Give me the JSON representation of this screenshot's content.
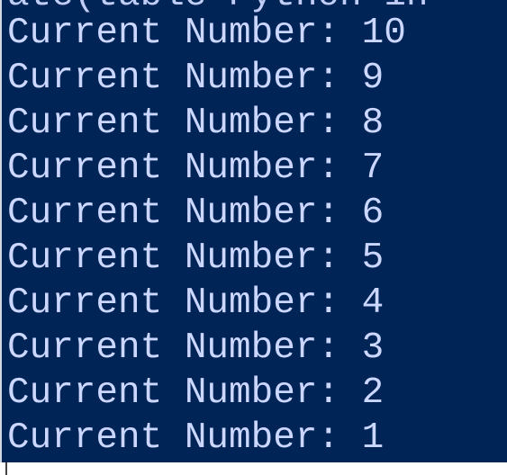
{
  "terminal": {
    "background": "#012456",
    "text_color": "#cbd7ff",
    "partial_top_text": "ate(table-Python 1n",
    "lines": [
      "Current Number: 10",
      "Current Number: 9",
      "Current Number: 8",
      "Current Number: 7",
      "Current Number: 6",
      "Current Number: 5",
      "Current Number: 4",
      "Current Number: 3",
      "Current Number: 2",
      "Current Number: 1"
    ]
  }
}
